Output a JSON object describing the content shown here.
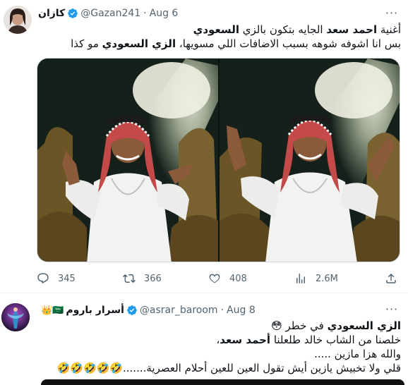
{
  "tweet1": {
    "display_name": "كازان",
    "handle": "@Gazan241",
    "date": "Aug 6",
    "line1": {
      "pre": "أغنية ",
      "bold1": "احمد سعد",
      "mid": " الجايه بتكون بالزي ",
      "bold2": "السعودي"
    },
    "line2": {
      "pre": "بس انا اشوفه شوهه بسبب الاضافات اللي مسويها، ",
      "bold": "الزي السعودي",
      "post": " مو كذا"
    },
    "metrics": {
      "replies": "345",
      "retweets": "366",
      "likes": "408",
      "views": "2.6M"
    }
  },
  "tweet2": {
    "display_name": "أسرار باروم",
    "badges": "👑🇸🇦",
    "handle": "@asrar_baroom",
    "date": "Aug 8",
    "line1": {
      "bold": "الزي السعودي",
      "post": " في خطر 😳"
    },
    "line2": {
      "pre": "خلصنا من الشاب خالد طلعلنا ",
      "bold": "أحمد سعد",
      "post": "،"
    },
    "line3": "والله هزا مازين .....",
    "line4": "قلي ولا تخبيش يازين أيش تقول العين للعين أحلام العصرية.......🤣🤣🤣🤣🤣"
  },
  "icons": {
    "verified": "verified-badge-icon",
    "more": "more-options-icon",
    "reply": "reply-icon",
    "retweet": "retweet-icon",
    "like": "like-icon",
    "views": "views-icon",
    "share": "share-icon"
  },
  "colors": {
    "verified_blue": "#1d9bf0",
    "muted_text": "#536471",
    "main_text": "#0f1419"
  }
}
